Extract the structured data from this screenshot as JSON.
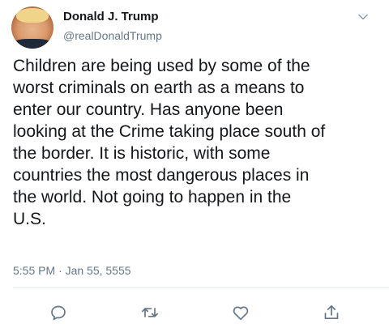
{
  "author": {
    "name": "Donald J. Trump",
    "handle": "@realDonaldTrump",
    "avatar_icon": "profile-photo"
  },
  "tweet": {
    "text": "Children are being used by some of the\nworst criminals on earth as a means to\nenter our country. Has anyone been\nlooking at the Crime taking place south of\nthe border. It is historic, with some\ncountries the most dangerous places in\nthe world. Not going to happen in the\nU.S.",
    "timestamp": "5:55 PM · Jan 55, 5555"
  },
  "actions": [
    {
      "icon": "reply-icon"
    },
    {
      "icon": "retweet-icon"
    },
    {
      "icon": "like-icon"
    },
    {
      "icon": "share-icon"
    }
  ],
  "colors": {
    "text": "#14171a",
    "secondary": "#657786",
    "icon": "#657786",
    "divider": "#e6ecf0"
  }
}
